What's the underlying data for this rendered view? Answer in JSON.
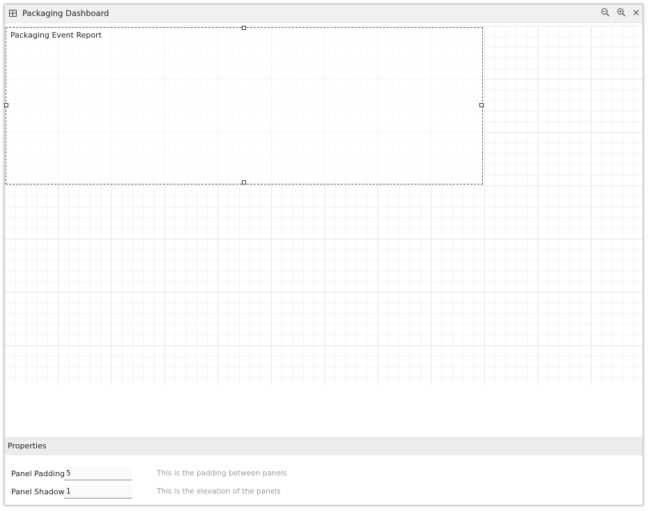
{
  "window": {
    "title": "Packaging Dashboard",
    "icons": {
      "app": "grid-table-icon",
      "zoom_out": "zoom-out-icon",
      "zoom_in": "zoom-in-icon",
      "close": "close-icon"
    }
  },
  "canvas": {
    "panel": {
      "title": "Packaging Event Report"
    }
  },
  "properties": {
    "header": "Properties",
    "rows": [
      {
        "label": "Panel Padding",
        "value": "5",
        "description": "This is the padding between panels"
      },
      {
        "label": "Panel Shadow",
        "value": "1",
        "description": "This is the elevation of the panels"
      }
    ]
  },
  "colors": {
    "titlebar_bg": "#f0f0f0",
    "grid_major": "#e6e6e6",
    "grid_minor": "#f2f2f2",
    "description_text": "#9a9a9a"
  }
}
